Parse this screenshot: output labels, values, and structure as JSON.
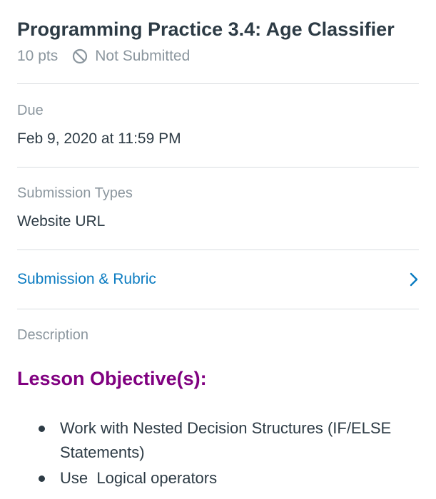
{
  "assignment": {
    "title": "Programming Practice 3.4: Age Classifier",
    "points": "10 pts",
    "status": "Not Submitted"
  },
  "due": {
    "label": "Due",
    "value": "Feb 9, 2020 at 11:59 PM"
  },
  "submission_types": {
    "label": "Submission Types",
    "value": "Website URL"
  },
  "submission_rubric": {
    "label": "Submission & Rubric"
  },
  "description": {
    "label": "Description",
    "heading": "Lesson Objective(s):",
    "items": [
      "Work with Nested Decision Structures (IF/ELSE Statements)",
      "Use  Logical operators"
    ]
  },
  "colors": {
    "text": "#2d3b45",
    "muted": "#8b969e",
    "link": "#0a7bc1",
    "heading_purple": "#800080",
    "divider": "#d9dde0"
  },
  "icons": {
    "status": "no-entry-icon",
    "chevron": "chevron-right-icon"
  }
}
